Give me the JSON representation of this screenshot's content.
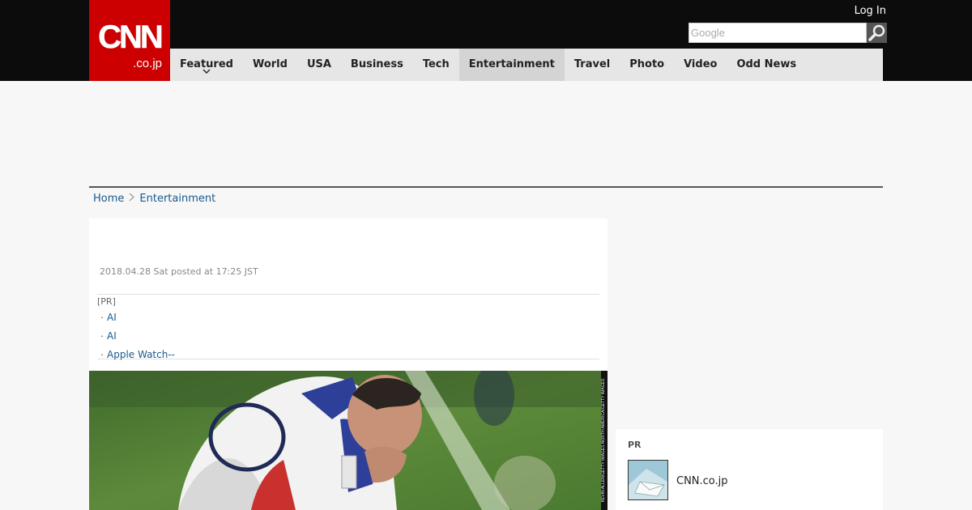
{
  "header": {
    "logo_main": "CNN",
    "logo_sub": ".co.jp",
    "login_label": "Log In",
    "search_placeholder": "Google"
  },
  "nav": {
    "items": [
      {
        "label": "Featured"
      },
      {
        "label": "World"
      },
      {
        "label": "USA"
      },
      {
        "label": "Business"
      },
      {
        "label": "Tech"
      },
      {
        "label": "Entertainment",
        "active": true
      },
      {
        "label": "Travel"
      },
      {
        "label": "Photo"
      },
      {
        "label": "Video"
      },
      {
        "label": "Odd News"
      }
    ]
  },
  "breadcrumb": {
    "home": "Home",
    "section": "Entertainment"
  },
  "article": {
    "posted": "2018.04.28 Sat posted at 17:25 JST",
    "pr_label": "[PR]",
    "pr_links": [
      "AI",
      "AI",
      "Apple Watch--"
    ],
    "photo_credit": "KEVIN ALLEN/GETTY IMAGES NORTH AMERICA/GETTY IMAGES"
  },
  "sidebar": {
    "pr_label": "PR",
    "link_text": "CNN.co.jp"
  },
  "colors": {
    "brand_red": "#cc0000",
    "topbar": "#0c0c0c",
    "link": "#1a5a8c"
  }
}
